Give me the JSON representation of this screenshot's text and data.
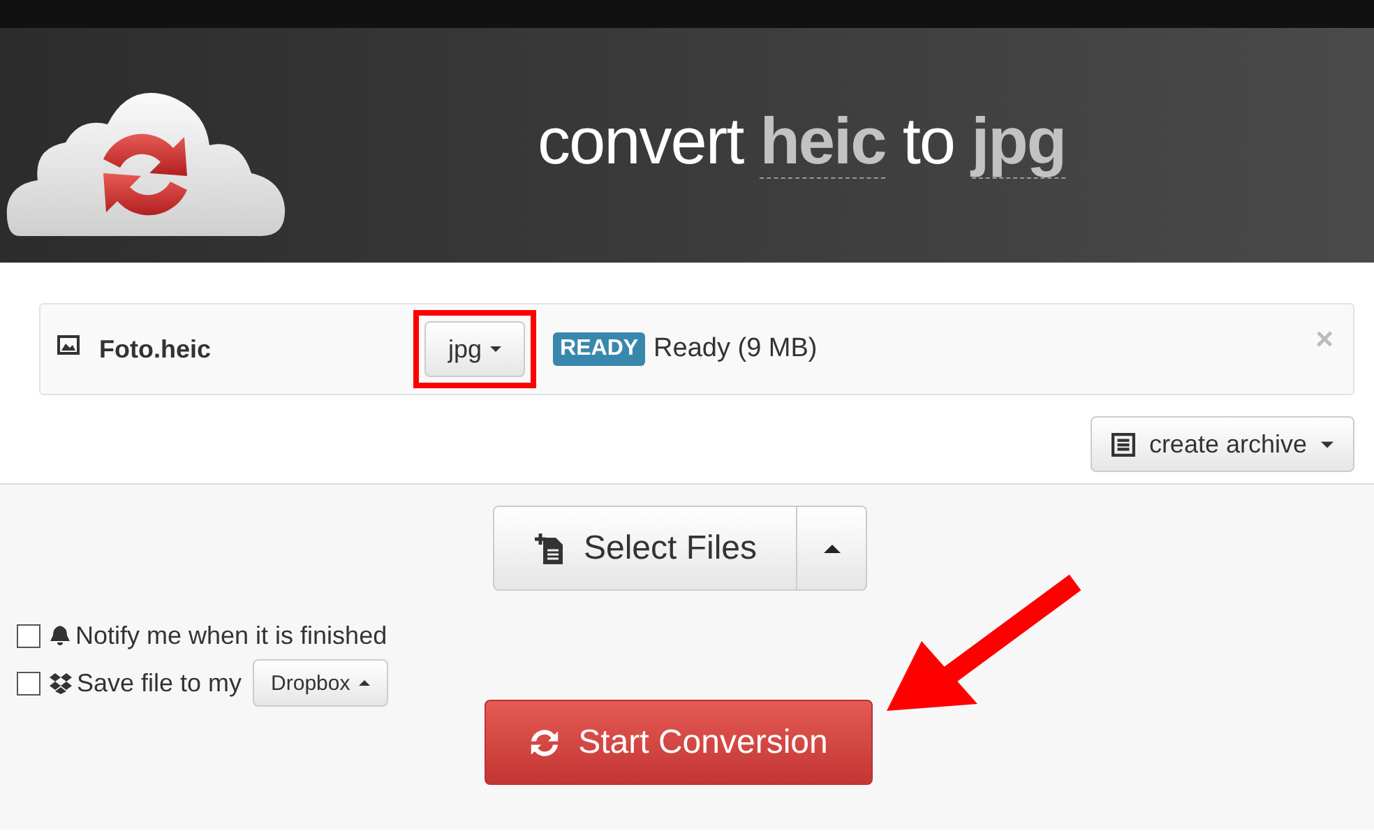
{
  "header": {
    "title": [
      {
        "text": "convert",
        "kind": "plain"
      },
      {
        "text": "heic",
        "kind": "format"
      },
      {
        "text": "to",
        "kind": "plain"
      },
      {
        "text": "jpg",
        "kind": "format"
      }
    ]
  },
  "file": {
    "name": "Foto.heic",
    "format": "jpg",
    "highlighted": true,
    "badge": "READY",
    "status": "Ready (9 MB)",
    "close": "×"
  },
  "archive_button": "create archive",
  "select_files": "Select Files",
  "options": [
    {
      "kind": "notify",
      "label": "Notify me when it is finished",
      "checked": false
    },
    {
      "kind": "dropbox",
      "label": "Save file to my",
      "checked": false,
      "dropdown": "Dropbox"
    }
  ],
  "start_button": "Start Conversion"
}
